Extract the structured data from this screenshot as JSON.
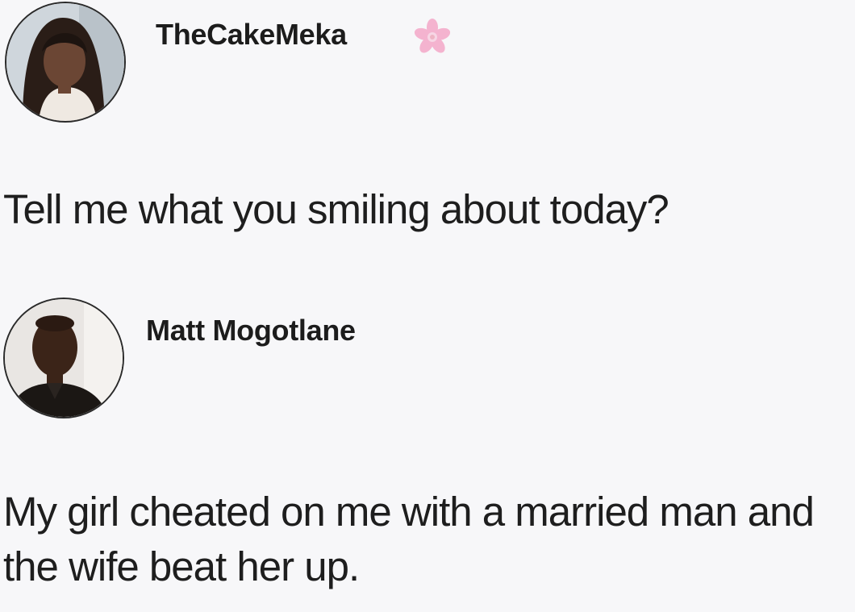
{
  "posts": [
    {
      "username": "TheCakeMeka",
      "username_icon": "pink-flower-icon",
      "text": "Tell me what you smiling about today?"
    },
    {
      "username": "Matt Mogotlane",
      "text": "My girl cheated on me with a married man and the wife beat her up."
    }
  ],
  "colors": {
    "background": "#f7f7f9",
    "text": "#1e1e1e",
    "flower": "#f2a6c8"
  }
}
